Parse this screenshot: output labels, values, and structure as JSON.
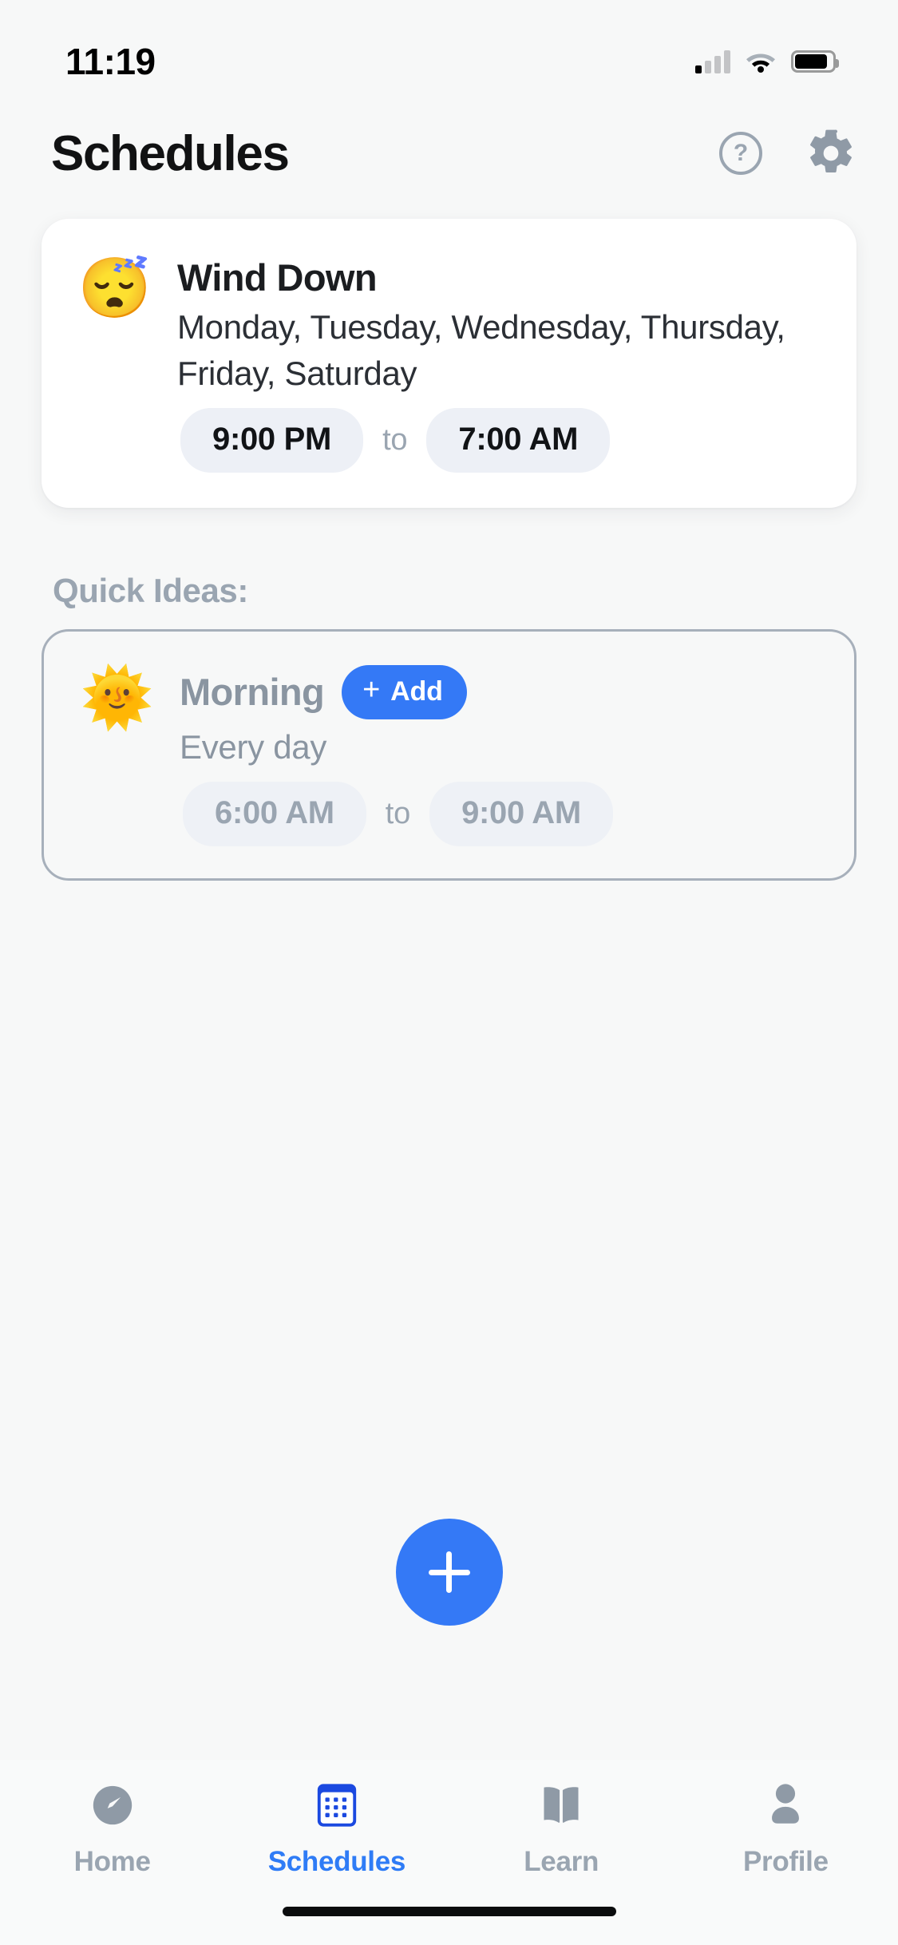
{
  "status_bar": {
    "time": "11:19",
    "signal_icon": "cellular-signal-icon",
    "wifi_icon": "wifi-icon",
    "battery_icon": "battery-icon"
  },
  "header": {
    "title": "Schedules",
    "help_icon": "help-circle-icon",
    "help_glyph": "?",
    "settings_icon": "gear-icon"
  },
  "schedules": [
    {
      "emoji": "😴",
      "emoji_name": "sleeping-face-emoji",
      "title": "Wind Down",
      "days": "Monday, Tuesday, Wednesday, Thursday, Friday, Saturday",
      "start_time": "9:00 PM",
      "separator": "to",
      "end_time": "7:00 AM"
    }
  ],
  "quick_ideas": {
    "label": "Quick Ideas:",
    "items": [
      {
        "emoji": "🌞",
        "emoji_name": "sun-with-face-emoji",
        "title": "Morning",
        "add_label": "Add",
        "add_plus": "+",
        "days": "Every day",
        "start_time": "6:00 AM",
        "separator": "to",
        "end_time": "9:00 AM"
      }
    ]
  },
  "fab": {
    "icon": "plus-icon",
    "label": "+"
  },
  "tabbar": {
    "items": [
      {
        "label": "Home",
        "icon": "speedometer-icon",
        "active": false
      },
      {
        "label": "Schedules",
        "icon": "calendar-icon",
        "active": true
      },
      {
        "label": "Learn",
        "icon": "open-book-icon",
        "active": false
      },
      {
        "label": "Profile",
        "icon": "person-icon",
        "active": false
      }
    ]
  },
  "colors": {
    "accent": "#3479f6",
    "muted": "#9aa5b1",
    "background": "#f7f8f8",
    "card": "#ffffff",
    "pill": "#edf0f6"
  }
}
